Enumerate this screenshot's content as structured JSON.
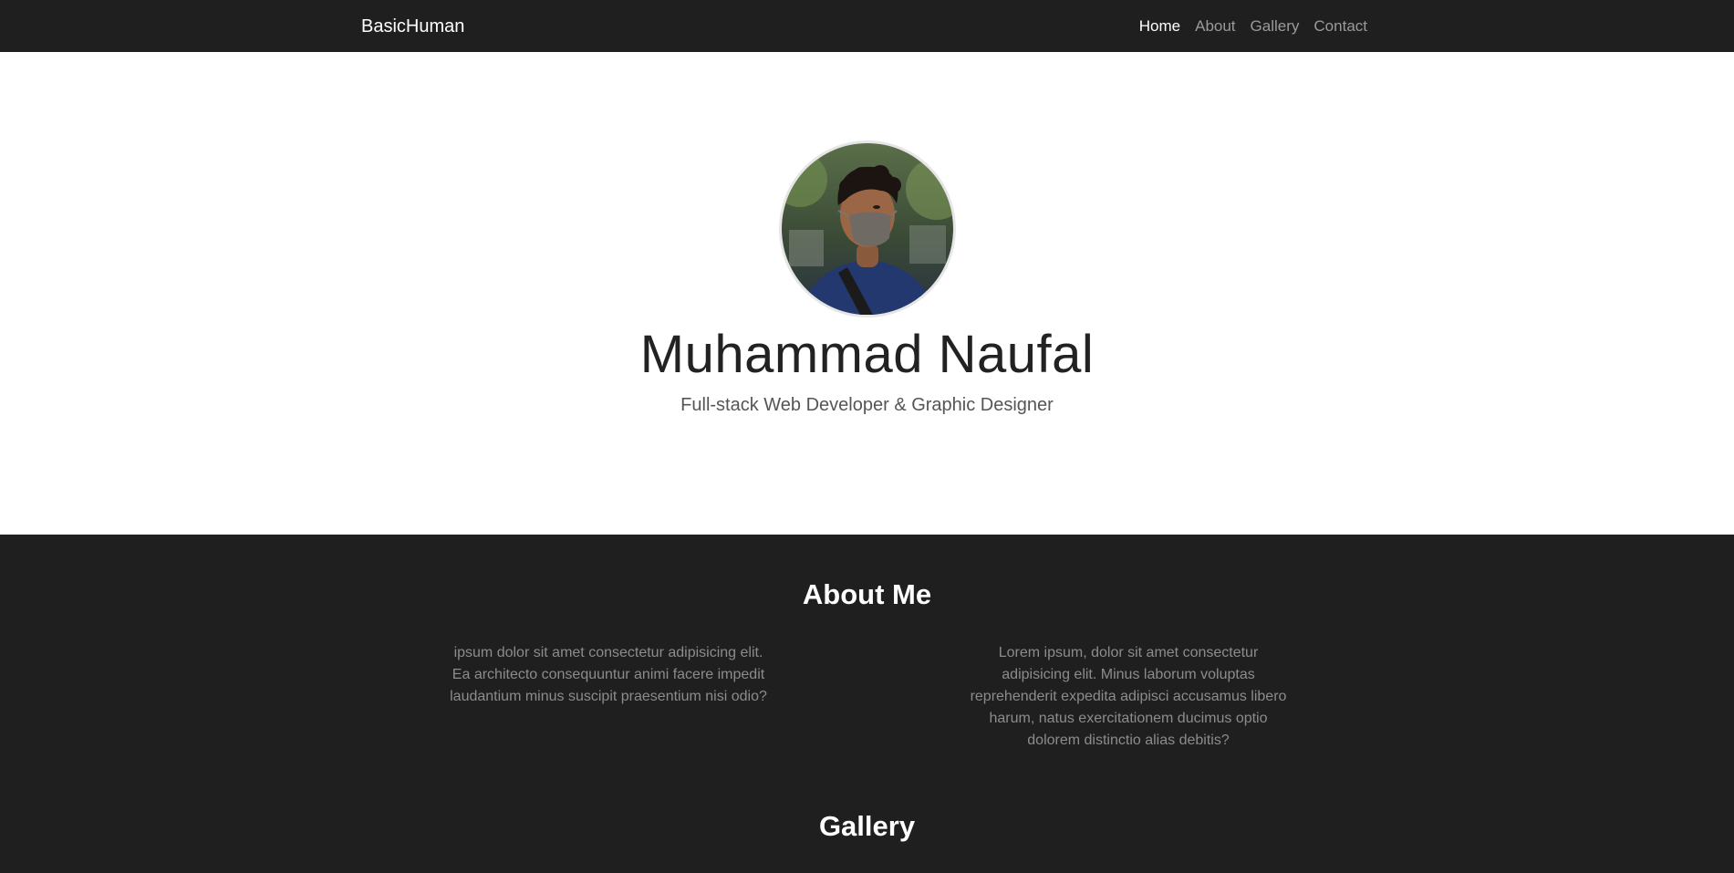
{
  "navbar": {
    "brand": "BasicHuman",
    "links": [
      {
        "label": "Home",
        "active": true
      },
      {
        "label": "About",
        "active": false
      },
      {
        "label": "Gallery",
        "active": false
      },
      {
        "label": "Contact",
        "active": false
      }
    ]
  },
  "hero": {
    "name": "Muhammad Naufal",
    "subtitle": "Full-stack Web Developer & Graphic Designer",
    "avatar_alt": "profile-photo"
  },
  "about": {
    "title": "About Me",
    "paragraphs": [
      "ipsum dolor sit amet consectetur adipisicing elit. Ea architecto consequuntur animi facere impedit laudantium minus suscipit praesentium nisi odio?",
      "Lorem ipsum, dolor sit amet consectetur adipisicing elit. Minus laborum voluptas reprehenderit expedita adipisci accusamus libero harum, natus exercitationem ducimus optio dolorem distinctio alias debitis?"
    ]
  },
  "gallery": {
    "title": "Gallery"
  },
  "colors": {
    "navbar_bg": "#1f1f1f",
    "dark_section_bg": "#1f1f1f",
    "nav_link_inactive": "#9a9a9a",
    "paragraph_text": "#8c8c8c"
  }
}
